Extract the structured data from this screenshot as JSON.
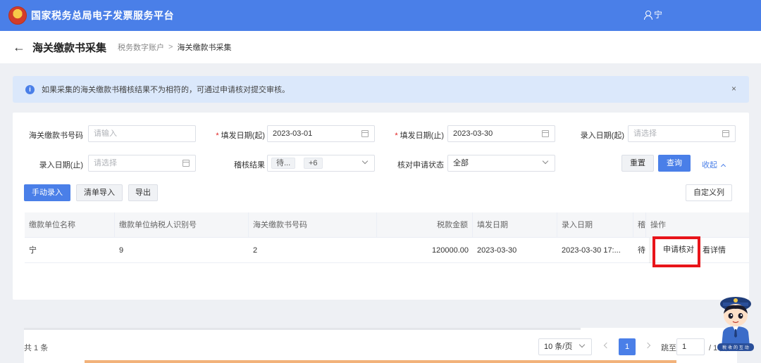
{
  "header": {
    "title": "国家税务总局电子发票服务平台",
    "user": "宁"
  },
  "pagehead": {
    "title": "海关缴款书采集",
    "breadcrumb_parent": "税务数字账户",
    "breadcrumb_sep": ">",
    "breadcrumb_current": "海关缴款书采集"
  },
  "alert": {
    "text": "如果采集的海关缴款书稽核结果不为相符的，可通过申请核对提交审核。",
    "close": "×"
  },
  "filters": {
    "customs_no_label": "海关缴款书号码",
    "customs_no_placeholder": "请输入",
    "fill_start_label": "填发日期(起)",
    "fill_start_value": "2023-03-01",
    "fill_end_label": "填发日期(止)",
    "fill_end_value": "2023-03-30",
    "entry_start_label": "录入日期(起)",
    "entry_start_placeholder": "请选择",
    "entry_end_label": "录入日期(止)",
    "entry_end_placeholder": "请选择",
    "audit_label": "稽核结果",
    "audit_tag": "待...",
    "audit_more": "+6",
    "verify_status_label": "核对申请状态",
    "verify_status_value": "全部",
    "reset": "重置",
    "query": "查询",
    "collapse": "收起",
    "required_mark": "*"
  },
  "toolbar": {
    "manual": "手动录入",
    "import": "清单导入",
    "export": "导出",
    "custom_columns": "自定义列"
  },
  "table": {
    "columns": [
      "缴款单位名称",
      "缴款单位纳税人识别号",
      "海关缴款书号码",
      "税款金额",
      "填发日期",
      "录入日期",
      "稽",
      "操作"
    ],
    "rows": [
      {
        "payer_name": "宁",
        "tax_id": "9",
        "customs_no": "2",
        "amount": "120000.00",
        "fill_date": "2023-03-30",
        "entry_date": "2023-03-30 17:...",
        "audit": "待",
        "action_apply": "申请核对",
        "action_detail": "看详情"
      }
    ]
  },
  "pager": {
    "total": "共 1 条",
    "page_size": "10 条/页",
    "current_page": "1",
    "goto_label": "跳至",
    "goto_value": "1",
    "pages_total": "/ 1 页"
  },
  "mascot": {
    "badge_text": "税 收 的 互 动"
  },
  "colors": {
    "primary": "#4a7fe8",
    "highlight": "#e8141a",
    "alert_bg": "#dbe8fb"
  }
}
